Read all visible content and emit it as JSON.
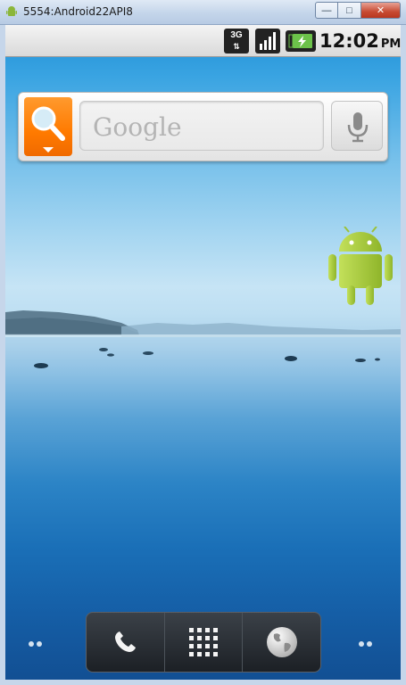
{
  "window": {
    "title": "5554:Android22API8",
    "minimize_glyph": "—",
    "maximize_glyph": "□",
    "close_glyph": "✕"
  },
  "status_bar": {
    "network_type": "3G",
    "time": "12:02",
    "ampm": "PM",
    "icons": [
      "3g-data-icon",
      "signal-strength-icon",
      "battery-charging-icon"
    ]
  },
  "search_widget": {
    "placeholder": "Google",
    "search_icon": "magnifier-icon",
    "voice_icon": "microphone-icon",
    "accent_color": "#ff7a00"
  },
  "home": {
    "desktop_icon": "android-robot-icon",
    "page_indicator_left": "••",
    "page_indicator_right": "••"
  },
  "dock": {
    "items": [
      {
        "name": "phone",
        "icon": "phone-handset-icon"
      },
      {
        "name": "launcher",
        "icon": "app-grid-icon"
      },
      {
        "name": "browser",
        "icon": "globe-icon"
      }
    ]
  },
  "colors": {
    "sky_top": "#1e8fd6",
    "horizon": "#c6e4f5",
    "water_bottom": "#124f93",
    "android_green": "#a4c639"
  }
}
